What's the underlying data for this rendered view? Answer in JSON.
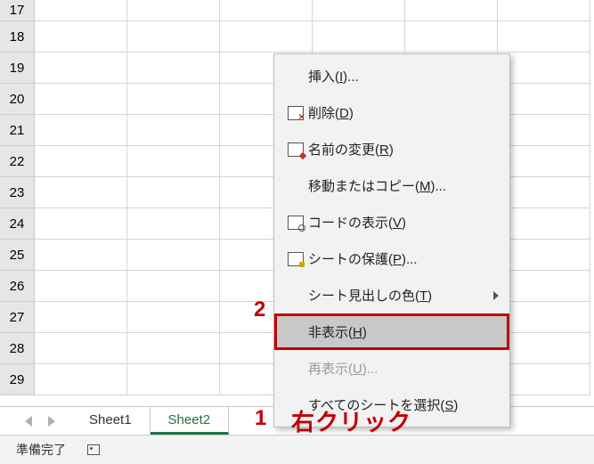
{
  "rows": [
    "17",
    "18",
    "19",
    "20",
    "21",
    "22",
    "23",
    "24",
    "25",
    "26",
    "27",
    "28",
    "29"
  ],
  "tabs": {
    "sheet1": "Sheet1",
    "sheet2": "Sheet2"
  },
  "status": {
    "ready": "準備完了"
  },
  "ctx": {
    "insert": "挿入(<u>I</u>)...",
    "delete": "削除(<u>D</u>)",
    "rename": "名前の変更(<u>R</u>)",
    "movecopy": "移動またはコピー(<u>M</u>)...",
    "viewcode": "コードの表示(<u>V</u>)",
    "protect": "シートの保護(<u>P</u>)...",
    "tabcolor": "シート見出しの色(<u>T</u>)",
    "hide": "非表示(<u>H</u>)",
    "unhide": "再表示(<u>U</u>)...",
    "selectall": "すべてのシートを選択(<u>S</u>)"
  },
  "anno": {
    "num1": "1",
    "num2": "2",
    "rightclick": "右クリック"
  }
}
